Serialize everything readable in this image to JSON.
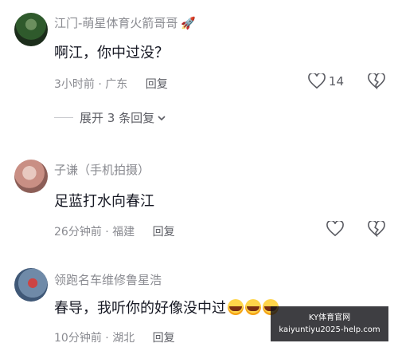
{
  "comments": [
    {
      "username": "江门-萌星体育火箭哥哥",
      "username_icon": "rocket-icon",
      "text": "啊江，你中过没？",
      "time": "3小时前",
      "location": "广东",
      "reply_label": "回复",
      "likes": "14",
      "replies_toggle": "展开 3 条回复"
    },
    {
      "username": "子谦（手机拍摄）",
      "text": "足蓝打水向春江",
      "time": "26分钟前",
      "location": "福建",
      "reply_label": "回复"
    },
    {
      "username": "领跑名车维修鲁星浩",
      "text": "春导，我听你的好像没中过",
      "emoji": "laugh-cry-emoji x3",
      "time": "10分钟前",
      "location": "湖北",
      "reply_label": "回复"
    }
  ],
  "watermark": {
    "line1": "KY体育官网",
    "line2": "kaiyuntiyu2025-help.com"
  }
}
